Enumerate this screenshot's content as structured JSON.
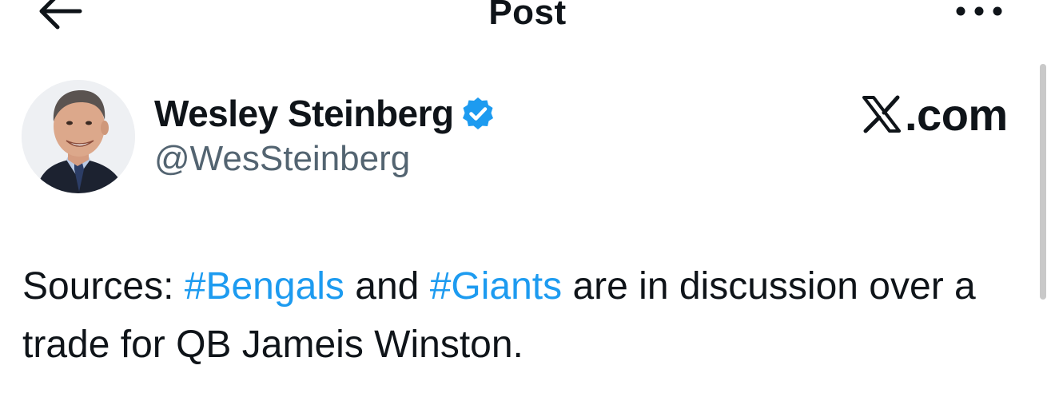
{
  "header": {
    "back_icon": "arrow-left-icon",
    "title": "Post",
    "more_icon": "more-horizontal-icon"
  },
  "post": {
    "author": {
      "display_name": "Wesley Steinberg",
      "handle": "@WesSteinberg",
      "verified": true,
      "verified_icon": "verified-badge-icon",
      "verified_color": "#1d9bf0"
    },
    "source": {
      "logo_icon": "x-logo-icon",
      "domain": ".com"
    },
    "text_parts": {
      "p1": "Sources: ",
      "tag1": "#Bengals",
      "p2": " and ",
      "tag2": "#Giants",
      "p3": " are in discussion over a trade for QB Jameis Winston."
    }
  },
  "colors": {
    "text": "#0f1419",
    "secondary": "#536471",
    "accent": "#1d9bf0"
  }
}
